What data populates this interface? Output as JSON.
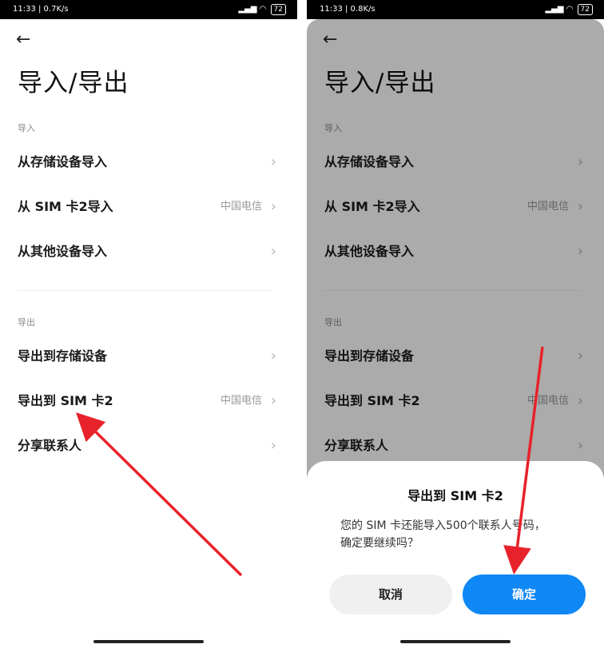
{
  "left_screen": {
    "status": {
      "time_speed": "11:33 | 0.7K/s",
      "battery": "72"
    },
    "back_icon": "←",
    "title": "导入/导出",
    "import_section": {
      "label": "导入",
      "items": [
        {
          "label": "从存储设备导入",
          "value": ""
        },
        {
          "label": "从 SIM 卡2导入",
          "value": "中国电信"
        },
        {
          "label": "从其他设备导入",
          "value": ""
        }
      ]
    },
    "export_section": {
      "label": "导出",
      "items": [
        {
          "label": "导出到存储设备",
          "value": ""
        },
        {
          "label": "导出到 SIM 卡2",
          "value": "中国电信"
        },
        {
          "label": "分享联系人",
          "value": ""
        }
      ]
    }
  },
  "right_screen": {
    "status": {
      "time_speed": "11:33 | 0.8K/s",
      "battery": "72"
    },
    "back_icon": "←",
    "title": "导入/导出",
    "import_section": {
      "label": "导入",
      "items": [
        {
          "label": "从存储设备导入",
          "value": ""
        },
        {
          "label": "从 SIM 卡2导入",
          "value": "中国电信"
        },
        {
          "label": "从其他设备导入",
          "value": ""
        }
      ]
    },
    "export_section": {
      "label": "导出",
      "items": [
        {
          "label": "导出到存储设备",
          "value": ""
        },
        {
          "label": "导出到 SIM 卡2",
          "value": "中国电信"
        },
        {
          "label": "分享联系人",
          "value": ""
        }
      ]
    },
    "dialog": {
      "title": "导出到 SIM 卡2",
      "message_line1": "您的 SIM 卡还能导入500个联系人号码，",
      "message_line2": "确定要继续吗？",
      "cancel_label": "取消",
      "confirm_label": "确定"
    }
  },
  "chevron_glyph": "›",
  "icons": {
    "status_signal": "signal-icon",
    "status_wifi": "wifi-icon",
    "back": "back-arrow-icon",
    "chevron": "chevron-right-icon"
  },
  "colors": {
    "accent": "#0f87f5",
    "annotation_arrow": "#e8222a",
    "dim_overlay": "rgba(0,0,0,0.33)"
  }
}
